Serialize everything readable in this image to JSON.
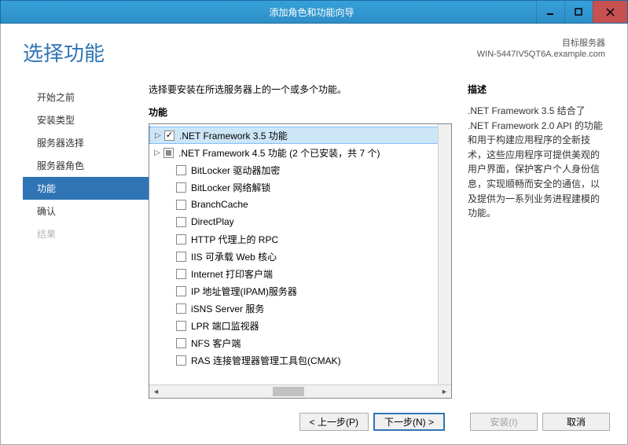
{
  "window": {
    "title": "添加角色和功能向导"
  },
  "header": {
    "heading": "选择功能",
    "target_label": "目标服务器",
    "target_host": "WIN-5447IV5QT6A.example.com"
  },
  "nav": {
    "items": [
      {
        "label": "开始之前",
        "state": "normal"
      },
      {
        "label": "安装类型",
        "state": "normal"
      },
      {
        "label": "服务器选择",
        "state": "normal"
      },
      {
        "label": "服务器角色",
        "state": "normal"
      },
      {
        "label": "功能",
        "state": "active"
      },
      {
        "label": "确认",
        "state": "normal"
      },
      {
        "label": "结果",
        "state": "disabled"
      }
    ]
  },
  "main": {
    "prompt": "选择要安装在所选服务器上的一个或多个功能。",
    "list_label": "功能",
    "features": [
      {
        "label": ".NET Framework 3.5 功能",
        "expandable": true,
        "check": "checked",
        "selected": true,
        "indent": 0
      },
      {
        "label": ".NET Framework 4.5 功能 (2 个已安装，共 7 个)",
        "expandable": true,
        "check": "partial",
        "indent": 0
      },
      {
        "label": "BitLocker 驱动器加密",
        "check": "none",
        "indent": 1
      },
      {
        "label": "BitLocker 网络解锁",
        "check": "none",
        "indent": 1
      },
      {
        "label": "BranchCache",
        "check": "none",
        "indent": 1
      },
      {
        "label": "DirectPlay",
        "check": "none",
        "indent": 1
      },
      {
        "label": "HTTP 代理上的 RPC",
        "check": "none",
        "indent": 1
      },
      {
        "label": "IIS 可承载 Web 核心",
        "check": "none",
        "indent": 1
      },
      {
        "label": "Internet 打印客户端",
        "check": "none",
        "indent": 1
      },
      {
        "label": "IP 地址管理(IPAM)服务器",
        "check": "none",
        "indent": 1
      },
      {
        "label": "iSNS Server 服务",
        "check": "none",
        "indent": 1
      },
      {
        "label": "LPR 端口监视器",
        "check": "none",
        "indent": 1
      },
      {
        "label": "NFS 客户端",
        "check": "none",
        "indent": 1
      },
      {
        "label": "RAS 连接管理器管理工具包(CMAK)",
        "check": "none",
        "indent": 1
      }
    ]
  },
  "desc": {
    "label": "描述",
    "text": ".NET Framework 3.5 结合了 .NET Framework 2.0 API 的功能和用于构建应用程序的全新技术，这些应用程序可提供美观的用户界面，保护客户个人身份信息，实现顺畅而安全的通信，以及提供为一系列业务进程建模的功能。"
  },
  "footer": {
    "prev": "< 上一步(P)",
    "next": "下一步(N) >",
    "install": "安装(I)",
    "cancel": "取消"
  }
}
